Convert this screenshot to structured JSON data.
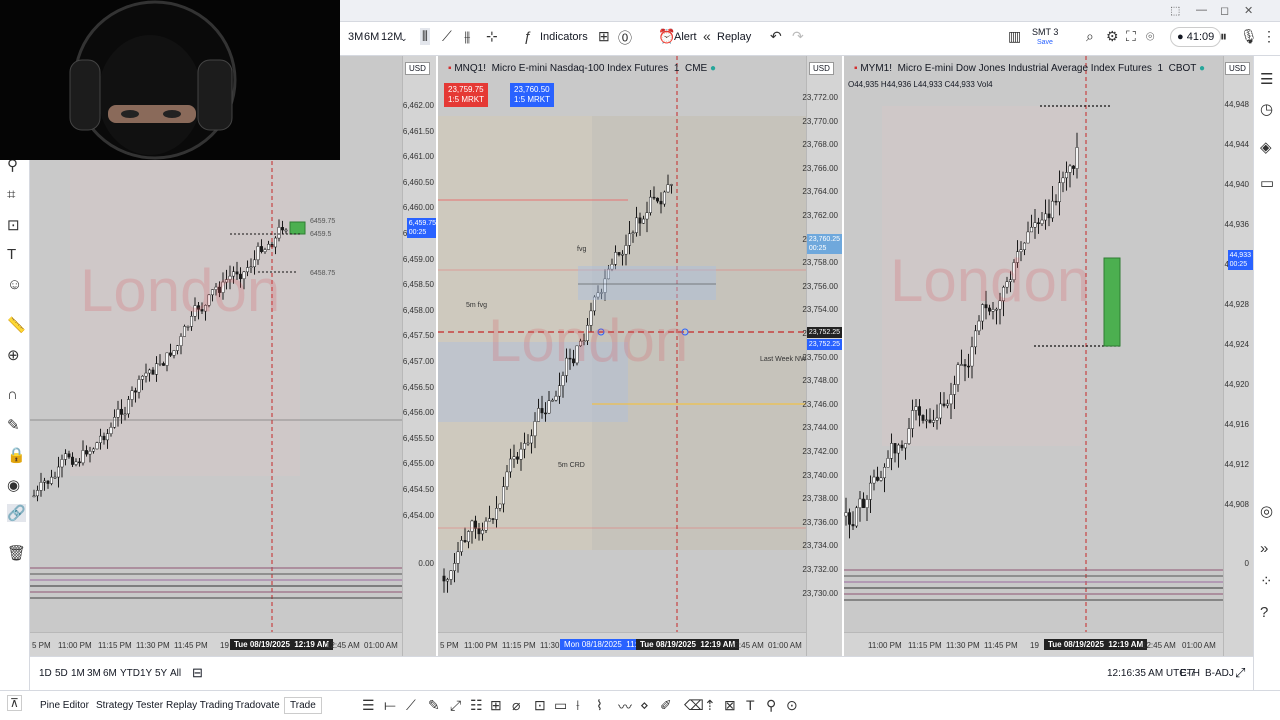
{
  "window": {
    "controls": [
      "⬚",
      "—",
      "◻",
      "✕"
    ]
  },
  "toolbar": {
    "intervals": [
      "3M",
      "6M",
      "12M"
    ],
    "indicators_label": "Indicators",
    "alert_label": "Alert",
    "replay_label": "Replay",
    "layout_name": "SMT 3",
    "layout_status": "Save",
    "timer": "41:09"
  },
  "charts": [
    {
      "currency": "USD",
      "price_ticks": [
        "6,462.00",
        "6,461.50",
        "6,461.00",
        "6,460.50",
        "6,460.00",
        "6,459.50",
        "6,459.00",
        "6,458.50",
        "6,458.00",
        "6,457.50",
        "6,457.00",
        "6,456.50",
        "6,456.00",
        "6,455.50",
        "6,455.00",
        "6,454.50",
        "6,454.00"
      ],
      "price_tag": "6,459.75",
      "price_tag_time": "00:25",
      "indicator_zero": "0.00",
      "watermark": "London",
      "time_labels": [
        "5 PM",
        "11:00 PM",
        "11:15 PM",
        "11:30 PM",
        "11:45 PM",
        "19",
        "Tue 08/19/2025",
        "12:19 AM",
        "12:45 AM",
        "01:00 AM"
      ],
      "level_labels": [
        "6459.75",
        "6459.5",
        "6458.75"
      ]
    },
    {
      "currency": "USD",
      "symbol": "MNQ1!",
      "name": "Micro E-mini Nasdaq-100 Index Futures",
      "interval": "1",
      "exchange": "CME",
      "sell_price": "23,759.75",
      "sell_label": "1:5 MRKT",
      "buy_price": "23,760.50",
      "buy_label": "1:5 MRKT",
      "price_ticks": [
        "23,772.00",
        "23,770.00",
        "23,768.00",
        "23,766.00",
        "23,764.00",
        "23,762.00",
        "23,760.00",
        "23,758.00",
        "23,756.00",
        "23,754.00",
        "23,752.00",
        "23,750.00",
        "23,748.00",
        "23,746.00",
        "23,744.00",
        "23,742.00",
        "23,740.00",
        "23,738.00",
        "23,736.00",
        "23,734.00",
        "23,732.00",
        "23,730.00"
      ],
      "price_tag": "23,760.25",
      "price_tag_time": "00:25",
      "tag_a": "23,752.25",
      "tag_b": "23,752.25",
      "annotations": {
        "fvg": "fvg",
        "fvg5m": "5m fvg",
        "last_week": "Last Week NWOG",
        "crd": "5m CRD"
      },
      "watermark": "London",
      "time_labels": [
        "5 PM",
        "11:00 PM",
        "11:15 PM",
        "11:30",
        "Mon 08/18/2025",
        "11:49 PM",
        "Tue 08/19/2025",
        "12:19 AM",
        "12:45 AM",
        "01:00 AM"
      ]
    },
    {
      "currency": "USD",
      "symbol": "MYM1!",
      "name": "Micro E-mini Dow Jones Industrial Average Index Futures",
      "interval": "1",
      "exchange": "CBOT",
      "ohlc": "O44,935 H44,936 L44,933 C44,933 Vol4",
      "price_ticks": [
        "44,948",
        "44,944",
        "44,940",
        "44,936",
        "44,932",
        "44,928",
        "44,924",
        "44,920",
        "44,916",
        "44,912",
        "44,908"
      ],
      "price_tag": "44,933",
      "price_tag_time": "00:25",
      "indicator_zero": "0",
      "watermark": "London",
      "time_labels": [
        "11:00 PM",
        "11:15 PM",
        "11:30 PM",
        "11:45 PM",
        "19",
        "Tue 08/19/2025",
        "12:19 AM",
        "12:45 AM",
        "01:00 AM"
      ]
    }
  ],
  "bottom": {
    "ranges": [
      "1D",
      "5D",
      "1M",
      "3M",
      "6M",
      "YTD",
      "1Y",
      "5Y",
      "All"
    ],
    "clock": "12:16:35 AM UTC-7",
    "session": "ETH",
    "adjust": "B-ADJ"
  },
  "panels": {
    "tabs": [
      "Pine Editor",
      "Strategy Tester",
      "Replay Trading",
      "Tradovate",
      "Trade"
    ]
  }
}
